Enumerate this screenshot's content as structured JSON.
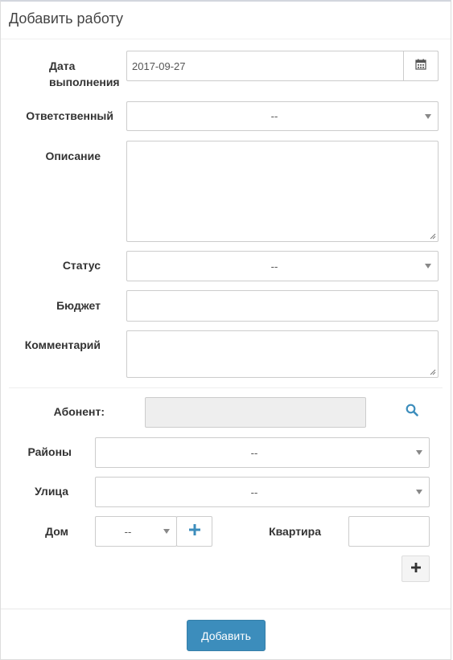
{
  "panel": {
    "title": "Добавить работу"
  },
  "form": {
    "date_label": "Дата выполнения",
    "date_value": "2017-09-27",
    "date_icon": "calendar-icon",
    "responsible_label": "Ответственный",
    "responsible_value": "--",
    "description_label": "Описание",
    "description_value": "",
    "status_label": "Статус",
    "status_value": "--",
    "budget_label": "Бюджет",
    "budget_value": "",
    "comment_label": "Комментарий",
    "comment_value": ""
  },
  "address": {
    "subscriber_label": "Абонент:",
    "subscriber_value": "",
    "search_icon": "search-icon",
    "districts_label": "Районы",
    "districts_value": "--",
    "street_label": "Улица",
    "street_value": "--",
    "house_label": "Дом",
    "house_value": "--",
    "apartment_label": "Квартира",
    "apartment_value": ""
  },
  "footer": {
    "submit_label": "Добавить"
  },
  "colors": {
    "primary": "#3c8dbc",
    "icon_blue": "#3c8dbc"
  }
}
